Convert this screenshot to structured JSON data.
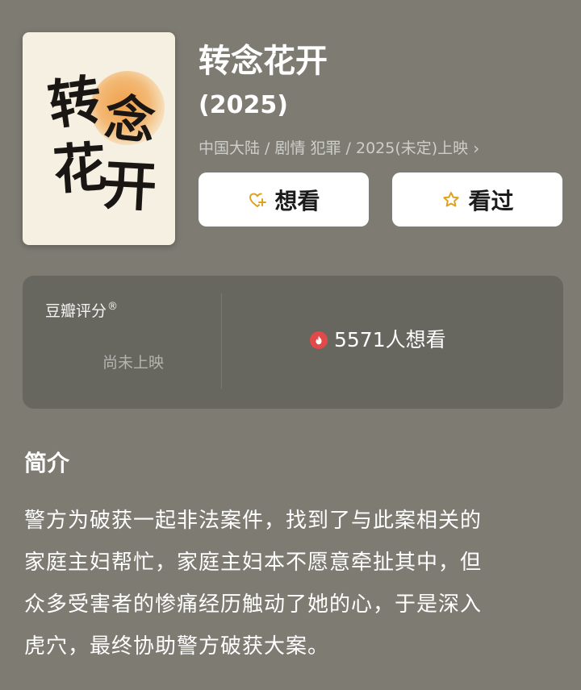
{
  "movie": {
    "poster_text": [
      "转",
      "念",
      "花",
      "开"
    ],
    "title": "转念花开",
    "year": "(2025)",
    "meta": "中国大陆 / 剧情 犯罪 / 2025(未定)上映",
    "meta_chevron_icon": "chevron-right-icon"
  },
  "actions": {
    "want_label": "想看",
    "want_icon": "heart-plus-icon",
    "seen_label": "看过",
    "seen_icon": "star-outline-icon",
    "icon_color": "#e0a21c"
  },
  "rating": {
    "label": "豆瓣评分",
    "registered_mark": "®",
    "status": "尚未上映",
    "wish_count_text": "5571人想看",
    "wish_icon": "fire-icon",
    "wish_icon_color": "#e24a4a"
  },
  "intro": {
    "heading": "简介",
    "lines": [
      "警方为破获一起非法案件，找到了与此案相关的",
      "家庭主妇帮忙，家庭主妇本不愿意牵扯其中，但",
      "众多受害者的惨痛经历触动了她的心，于是深入",
      "虎穴，最终协助警方破获大案。"
    ]
  }
}
